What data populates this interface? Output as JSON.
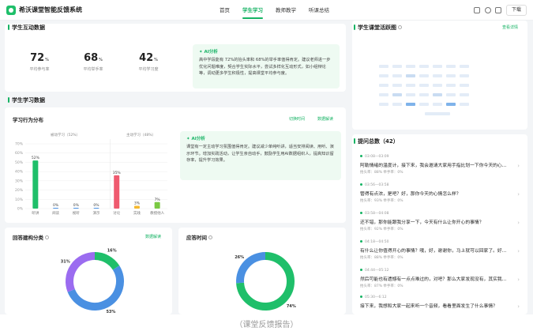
{
  "header": {
    "app_title": "希沃课堂智能反馈系统",
    "nav": [
      "首页",
      "学生学习",
      "教师教学",
      "听课总结"
    ],
    "active_nav": 1,
    "download": "下载",
    "tool_icons": [
      "message-icon",
      "settings-icon",
      "fullscreen-icon"
    ]
  },
  "interaction": {
    "title": "学生互动数据",
    "stats": [
      {
        "value": "72",
        "unit": "%",
        "label": "平均参与率"
      },
      {
        "value": "68",
        "unit": "%",
        "label": "平均举手率"
      },
      {
        "value": "42",
        "unit": "%",
        "label": "平均学习度"
      }
    ],
    "ai_tag": "AI分析",
    "ai_text": "高中学段能有 72%的抬头率和 68%的举手率值得肯定。建议老师进一步优化问题难度，契合学生实际水平，尝试多样化互动形式，如小组辩论等，调动更多学生积极性，提高课堂平均参与度。"
  },
  "learning": {
    "title": "学生学习数据",
    "behavior_title": "学习行为分布",
    "link_switch": "切换时间",
    "link_detail": "数据解读",
    "legend_passive": "被动学习（52%）",
    "legend_active": "主动学习（48%）",
    "ai_tag": "AI分析",
    "ai_text": "课堂有一定主动学习氛围值得肯定。建议减少单纯听讲，适当安排阅读、用听、演示环节。增加实践活动，让学生亲自动手，鼓励学生用AI数据组织人，提高知识留存率，提升学习效果。"
  },
  "chart_data": {
    "type": "bar",
    "categories": [
      "听讲",
      "阅读",
      "视听",
      "演示",
      "讨论",
      "实践",
      "教授他人"
    ],
    "values": [
      52,
      0,
      0,
      0,
      36,
      3,
      7
    ],
    "value_labels": [
      "52%",
      "0%",
      "0%",
      "0%",
      "35%",
      "3%",
      "7%"
    ],
    "colors": [
      "#1fbf6a",
      "#4a90e2",
      "#4a90e2",
      "#4a90e2",
      "#ef5a6f",
      "#f5b82e",
      "#7ac943"
    ],
    "ylim": [
      0,
      70
    ],
    "yticks": [
      "70%",
      "60%",
      "50%",
      "40%",
      "30%",
      "20%",
      "10%",
      "0%"
    ]
  },
  "answer_types": {
    "title": "回答建构分类",
    "link": "数据解读",
    "slices": [
      {
        "label": "16%",
        "value": 16,
        "color": "#1fbf6a"
      },
      {
        "label": "53%",
        "value": 53,
        "color": "#4a90e2"
      },
      {
        "label": "31%",
        "value": 31,
        "color": "#9b6cf0"
      }
    ]
  },
  "answer_time": {
    "title": "应答时间",
    "slices": [
      {
        "label": "74%",
        "value": 74,
        "color": "#1fbf6a"
      },
      {
        "label": "26%",
        "value": 26,
        "color": "#4a90e2"
      }
    ]
  },
  "activity": {
    "title": "学生课堂活跃图",
    "link": "查看详情",
    "colors": {
      "light": "#e3ecf7",
      "mid": "#c9dcf2",
      "strong": "#7fb3ea"
    }
  },
  "questions": {
    "title": "提问总数（42）",
    "items": [
      {
        "time": "03:08—03:09",
        "text": "阿勒情绪的温度计，接下来，我会邀请大家用手指比划一下你今天的心...",
        "meta": "抬头率：88%    举手率：0%"
      },
      {
        "time": "03:56—03:58",
        "text": "管得有点浓，是吧？好，那你今天的心情怎么样？",
        "meta": "抬头率：93%    举手率：0%"
      },
      {
        "time": "03:58—04:08",
        "text": "还不错，那你能跟我分享一下，今天有什么让你开心的事情？",
        "meta": "抬头率：92%    举手率：0%"
      },
      {
        "time": "04:18—04:50",
        "text": "有什么让你值得开心的事情？哦，好，谢谢你，马上就可以回家了。好...",
        "meta": "抬头率：88%    举手率：0%"
      },
      {
        "time": "04:44—05:12",
        "text": "然后可能也有遗憾有一点点难过的，对吧？那么大家发现没有，其实我...",
        "meta": "抬头率：87%    举手率：0%"
      },
      {
        "time": "05:30—6:12",
        "text": "接下来，我想和大家一起来听一个音频，看看里面发生了什么事情？",
        "meta": "抬头率：85%    举手率：0%"
      }
    ]
  },
  "caption": "（课堂反馈报告）"
}
